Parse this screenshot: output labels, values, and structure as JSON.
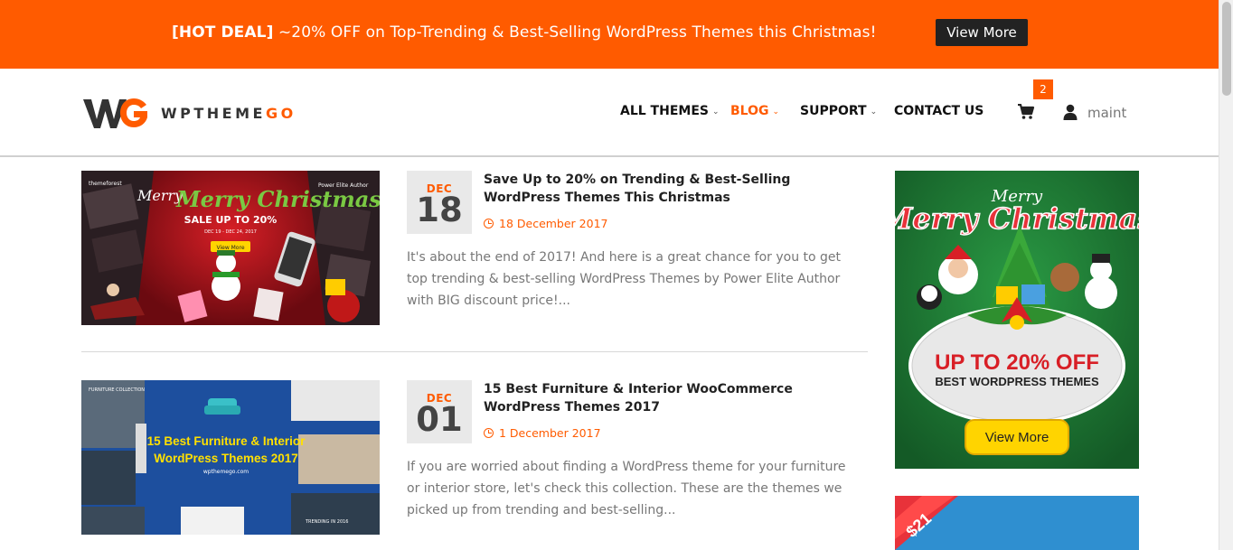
{
  "promo": {
    "tag": "[HOT DEAL]",
    "text": " ~20% OFF on Top-Trending & Best-Selling WordPress Themes this Christmas!",
    "button": "View More"
  },
  "brand": {
    "logo_mark": "WG",
    "name_main": "WPTHEME",
    "name_accent": "GO"
  },
  "nav": {
    "items": [
      {
        "label": "ALL THEMES",
        "has_dropdown": true,
        "active": false
      },
      {
        "label": "BLOG",
        "has_dropdown": true,
        "active": true
      },
      {
        "label": "SUPPORT",
        "has_dropdown": true,
        "active": false
      },
      {
        "label": "CONTACT US",
        "has_dropdown": false,
        "active": false
      }
    ],
    "cart_count": "2",
    "user": "maint",
    "icons": [
      "cart-icon",
      "user-icon",
      "chevron-down-icon"
    ]
  },
  "posts": [
    {
      "month": "DEC",
      "day": "18",
      "title": "Save Up to 20% on Trending & Best-Selling WordPress Themes This Christmas",
      "date": "18 December 2017",
      "excerpt": "It's about the end of 2017! And here is a great chance for you to get top trending & best-selling WordPress Themes by Power Elite Author with BIG discount price!...",
      "thumb": {
        "brand_left": "themeforest",
        "brand_right": "Power Elite Author",
        "headline": "Merry Christmas",
        "sale": "SALE UP TO 20%",
        "dates": "DEC 19 - DEC 24, 2017",
        "button": "View More"
      }
    },
    {
      "month": "DEC",
      "day": "01",
      "title": "15 Best Furniture & Interior WooCommerce WordPress Themes 2017",
      "date": "1 December 2017",
      "excerpt": "If you are worried about finding a WordPress theme for your furniture or interior store, let's check this collection. These are the themes we picked up from trending and best-selling...",
      "thumb": {
        "headline": "15 Best Furniture & Interior WordPress Themes 2017",
        "site": "wpthemego.com",
        "label_top": "FURNITURE COLLECTION",
        "label_bottom": "TRENDING IN 2016"
      }
    }
  ],
  "sidebar": {
    "ad1": {
      "headline": "Merry Christmas",
      "offer": "UP TO 20% OFF",
      "sub": "BEST WORDPRESS THEMES",
      "button": "View More"
    },
    "ad2": {
      "price": "$21"
    }
  },
  "colors": {
    "accent": "#ff5b00",
    "promo_bg": "#ff5b00",
    "dark_button": "#222222",
    "ad_green": "#1e7a34",
    "ad_button": "#ffd400"
  }
}
